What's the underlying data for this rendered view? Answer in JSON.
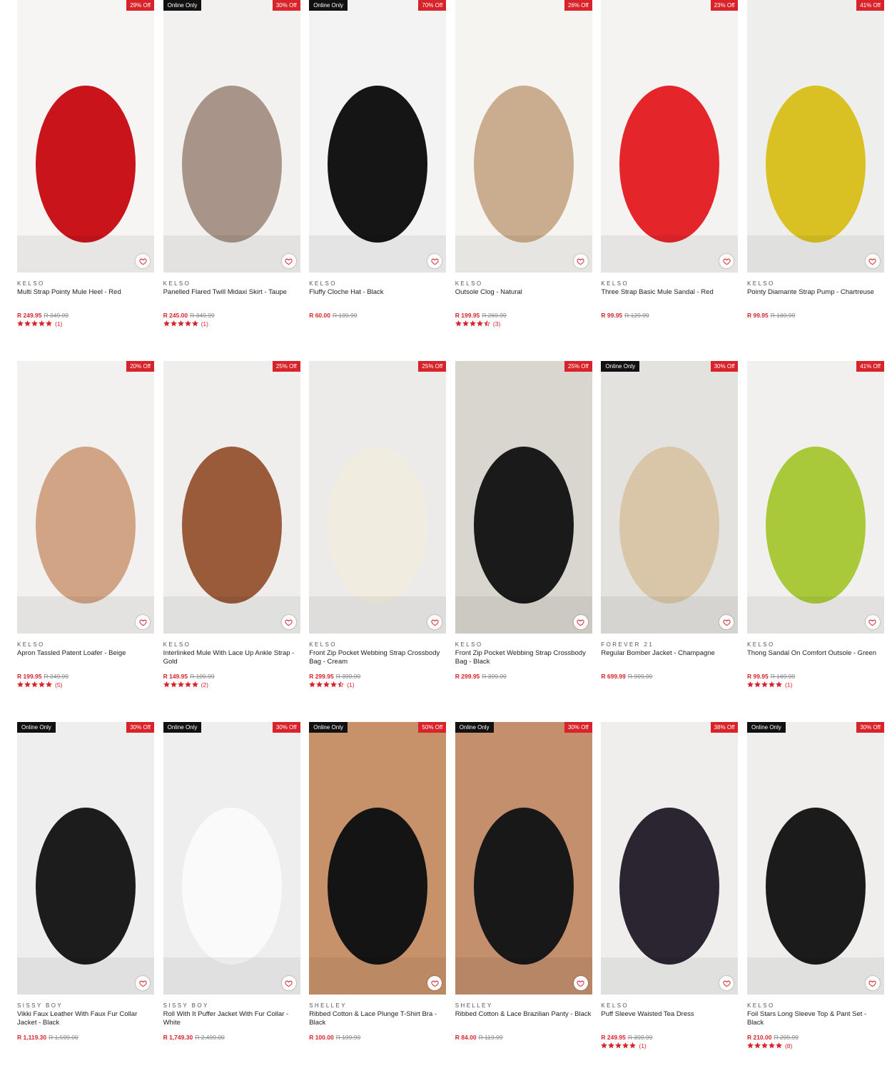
{
  "colors": {
    "accent": "#d8232a",
    "badge_dark": "#111111"
  },
  "icons": {
    "wishlist": "heart-outline-icon",
    "rating": "star-icon"
  },
  "products": [
    {
      "brand": "KELSO",
      "name": "Multi Strap Pointy Mule Heel - Red",
      "price": "R 249.95",
      "was": "R 349.99",
      "discount": "29% Off",
      "online_only": "",
      "rating": 5,
      "reviews": "(1)",
      "tone": [
        "#f6f5f3",
        "#c9141c"
      ]
    },
    {
      "brand": "KELSO",
      "name": "Panelled Flared Twill Midaxi Skirt - Taupe",
      "price": "R 245.00",
      "was": "R 349.99",
      "discount": "30% Off",
      "online_only": "Online Only",
      "rating": 5,
      "reviews": "(1)",
      "tone": [
        "#f2f1ef",
        "#a89488"
      ]
    },
    {
      "brand": "KELSO",
      "name": "Fluffy Cloche Hat - Black",
      "price": "R 60.00",
      "was": "R 199.99",
      "discount": "70% Off",
      "online_only": "Online Only",
      "rating": 0,
      "reviews": "",
      "tone": [
        "#f3f3f3",
        "#151515"
      ]
    },
    {
      "brand": "KELSO",
      "name": "Outsole Clog - Natural",
      "price": "R 199.95",
      "was": "R 269.99",
      "discount": "26% Off",
      "online_only": "",
      "rating": 4.5,
      "reviews": "(3)",
      "tone": [
        "#f5f4f1",
        "#c9ad8e"
      ]
    },
    {
      "brand": "KELSO",
      "name": "Three Strap Basic Mule Sandal - Red",
      "price": "R 99.95",
      "was": "R 129.99",
      "discount": "23% Off",
      "online_only": "",
      "rating": 0,
      "reviews": "",
      "tone": [
        "#f4f3f1",
        "#e4262a"
      ]
    },
    {
      "brand": "KELSO",
      "name": "Pointy Diamante Strap Pump - Chartreuse",
      "price": "R 99.95",
      "was": "R 169.99",
      "discount": "41% Off",
      "online_only": "",
      "rating": 0,
      "reviews": "",
      "tone": [
        "#eeeeec",
        "#d9c123"
      ]
    },
    {
      "brand": "KELSO",
      "name": "Apron Tassled Patent Loafer - Beige",
      "price": "R 199.95",
      "was": "R 249.99",
      "discount": "20% Off",
      "online_only": "",
      "rating": 5,
      "reviews": "(5)",
      "tone": [
        "#f2f1ef",
        "#d2a486"
      ]
    },
    {
      "brand": "KELSO",
      "name": "Interlinked Mule With Lace Up Ankle Strap - Gold",
      "price": "R 149.95",
      "was": "R 199.99",
      "discount": "25% Off",
      "online_only": "",
      "rating": 5,
      "reviews": "(2)",
      "tone": [
        "#efeeec",
        "#9a5b3a"
      ]
    },
    {
      "brand": "KELSO",
      "name": "Front Zip Pocket Webbing Strap Crossbody Bag - Cream",
      "price": "R 299.95",
      "was": "R 399.99",
      "discount": "25% Off",
      "online_only": "",
      "rating": 4.5,
      "reviews": "(1)",
      "tone": [
        "#ecebe9",
        "#f1ece0"
      ]
    },
    {
      "brand": "KELSO",
      "name": "Front Zip Pocket Webbing Strap Crossbody Bag - Black",
      "price": "R 299.95",
      "was": "R 399.99",
      "discount": "25% Off",
      "online_only": "",
      "rating": 0,
      "reviews": "",
      "tone": [
        "#d9d6d0",
        "#1a1a1a"
      ]
    },
    {
      "brand": "FOREVER 21",
      "name": "Regular Bomber Jacket - Champagne",
      "price": "R 699.99",
      "was": "R 999.99",
      "discount": "30% Off",
      "online_only": "Online Only",
      "rating": 0,
      "reviews": "",
      "tone": [
        "#e4e2df",
        "#d9c6a9"
      ]
    },
    {
      "brand": "KELSO",
      "name": "Thong Sandal On Comfort Outsole - Green",
      "price": "R 99.95",
      "was": "R 169.99",
      "discount": "41% Off",
      "online_only": "",
      "rating": 5,
      "reviews": "(1)",
      "tone": [
        "#f1f0ee",
        "#a9c93a"
      ]
    },
    {
      "brand": "SISSY BOY",
      "name": "Vikki Faux Leather With Faux Fur Collar Jacket - Black",
      "price": "R 1,119.30",
      "was": "R 1,599.00",
      "discount": "30% Off",
      "online_only": "Online Only",
      "rating": 0,
      "reviews": "",
      "tone": [
        "#eeeeee",
        "#1c1c1c"
      ]
    },
    {
      "brand": "SISSY BOY",
      "name": "Roll With It Puffer Jacket With Fur Collar - White",
      "price": "R 1,749.30",
      "was": "R 2,499.00",
      "discount": "30% Off",
      "online_only": "Online Only",
      "rating": 0,
      "reviews": "",
      "tone": [
        "#eeeeee",
        "#fafafa"
      ]
    },
    {
      "brand": "SHELLEY",
      "name": "Ribbed Cotton & Lace Plunge T-Shirt Bra - Black",
      "price": "R 100.00",
      "was": "R 199.99",
      "discount": "50% Off",
      "online_only": "Online Only",
      "rating": 0,
      "reviews": "",
      "tone": [
        "#c7926a",
        "#141414"
      ]
    },
    {
      "brand": "SHELLEY",
      "name": "Ribbed Cotton & Lace Brazilian Panty - Black",
      "price": "R 84.00",
      "was": "R 119.99",
      "discount": "30% Off",
      "online_only": "Online Only",
      "rating": 0,
      "reviews": "",
      "tone": [
        "#c38f6d",
        "#181818"
      ]
    },
    {
      "brand": "KELSO",
      "name": "Puff Sleeve Waisted Tea Dress",
      "price": "R 249.95",
      "was": "R 399.99",
      "discount": "38% Off",
      "online_only": "",
      "rating": 5,
      "reviews": "(1)",
      "tone": [
        "#efeeec",
        "#2a2530"
      ]
    },
    {
      "brand": "KELSO",
      "name": "Foil Stars Long Sleeve Top & Pant Set - Black",
      "price": "R 210.00",
      "was": "R 299.99",
      "discount": "30% Off",
      "online_only": "Online Only",
      "rating": 5,
      "reviews": "(8)",
      "tone": [
        "#efeeec",
        "#1b1b1b"
      ]
    }
  ]
}
